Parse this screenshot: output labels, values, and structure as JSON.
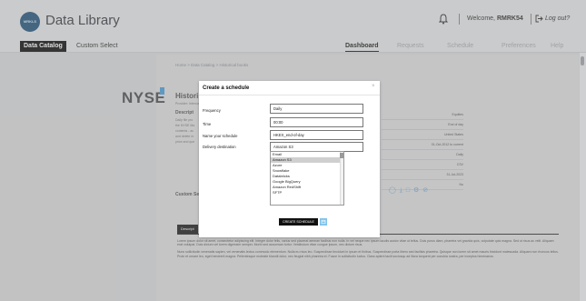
{
  "header": {
    "logo_text": "MRKLS",
    "app_title": "Data Library",
    "welcome_prefix": "Welcome,",
    "username": "RMRK54",
    "logout_label": "Log out?"
  },
  "nav": {
    "items": [
      {
        "label": "Data Catalog"
      },
      {
        "label": "Custom Select"
      },
      {
        "label": "Dashboard"
      },
      {
        "label": "Requests"
      },
      {
        "label": "Schedule"
      },
      {
        "label": "Preferences"
      },
      {
        "label": "Help"
      }
    ]
  },
  "background": {
    "breadcrumb": "Home  >  Data Catalog  >  Historical books",
    "brand": "NYSE",
    "dataset_title": "Histori",
    "provider": "Provider: Intercontin",
    "description_heading": "Descript",
    "description_lines": [
      "Daily file pro",
      "the NYSE Ma",
      "contents - ac",
      "and delete m",
      "price and que"
    ],
    "meta_values": [
      "Equities",
      "End of day",
      "United States",
      "01-Oct-2012 to current",
      "Daily",
      "CSV",
      "31-Jul-2023",
      "No"
    ],
    "custom_section": "Custom Se",
    "desc_tab": "Descript",
    "lorem_1": "Lorem ipsum dolor sit amet, consectetur adipiscing elit. Integer dolor felis, varius sed placerat aenean facilisis non nulla. In vel neque nec ipsum iaculis auctor vitae ut tellus. Duis purus diam, pharetra vel gravida quis, vulputate quis magna. Sed ut risus ac velit. Aliquam erat volutpat. Duis dictum vel lorem dignissim semper. Morbi sed accumsan tortor. Vestibulum vitae congue ipsum, nec dictum risus.",
    "lorem_2": "Nunc sollicitudin venenatis sapien, vel venenatis lectus commodo elementum. Nulla eu risus leo. Suspendisse tincidunt in ipsum et finibus. Suspendisse porta libero sed facilisis pharetra. Quisque non lorem sit amet mauris tincidunt malesuada. Aliquam non rhoncus tellus. Proin et ornare leo, eget hendrerit magna. Pellentesque molestie blandit dolor, nec feugiat nibh pharetra et. Fusce in sollicitudin luctus. Class aptent taciti sociosqu ad litora torquent per conubia nostra, per inceptos himenaeos."
  },
  "modal": {
    "title": "Create a schedule",
    "close_icon": "×",
    "fields": {
      "frequency": {
        "label": "Frequency",
        "value": "Daily"
      },
      "time": {
        "label": "Time",
        "value": "00:00"
      },
      "name": {
        "label": "Name your schedule",
        "value": "HKEX_end-of-day"
      },
      "destination": {
        "label": "Delivery destination",
        "value": "Amazon S3"
      }
    },
    "destination_options": [
      "Email",
      "Amazon S3",
      "Azure",
      "Snowflake",
      "Databricks",
      "Google BigQuery",
      "Amazon RedShift",
      "SFTP"
    ],
    "selected_option": "Amazon S3",
    "create_label": "CREATE SCHEDULE"
  },
  "colors": {
    "accent": "#4d9fd8",
    "dark": "#111111",
    "button_icon": "#7fc3ea"
  }
}
